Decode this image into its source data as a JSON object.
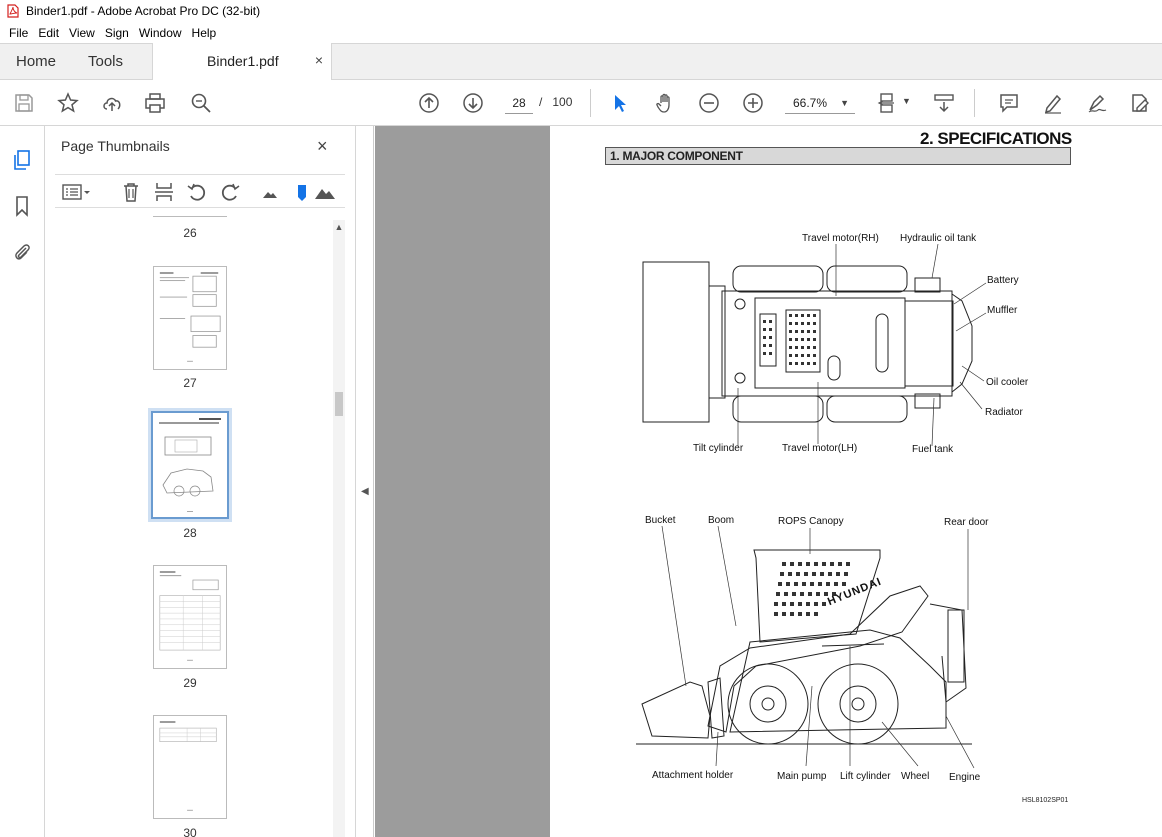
{
  "window": {
    "title": "Binder1.pdf - Adobe Acrobat Pro DC (32-bit)"
  },
  "menu": [
    "File",
    "Edit",
    "View",
    "Sign",
    "Window",
    "Help"
  ],
  "tabs": {
    "home": "Home",
    "tools": "Tools",
    "document": "Binder1.pdf",
    "close_glyph": "×"
  },
  "toolbar": {
    "current_page": "28",
    "page_separator": "/",
    "total_pages": "100",
    "zoom": "66.7%"
  },
  "thumbnail_panel": {
    "title": "Page Thumbnails",
    "close_glyph": "×",
    "thumbnails": [
      {
        "page": "26"
      },
      {
        "page": "27"
      },
      {
        "page": "28",
        "selected": true
      },
      {
        "page": "29"
      },
      {
        "page": "30"
      }
    ]
  },
  "document_page": {
    "section_title": "2. SPECIFICATIONS",
    "subsection_title": "1. MAJOR COMPONENT",
    "top_view_labels": {
      "travel_motor_rh": "Travel motor(RH)",
      "hydraulic_oil_tank": "Hydraulic oil tank",
      "battery": "Battery",
      "muffler": "Muffler",
      "oil_cooler": "Oil cooler",
      "radiator": "Radiator",
      "tilt_cylinder": "Tilt cylinder",
      "travel_motor_lh": "Travel motor(LH)",
      "fuel_tank": "Fuel tank"
    },
    "side_view_labels": {
      "bucket": "Bucket",
      "boom": "Boom",
      "rops_canopy": "ROPS Canopy",
      "rear_door": "Rear door",
      "attachment_holder": "Attachment holder",
      "main_pump": "Main pump",
      "lift_cylinder": "Lift cylinder",
      "wheel": "Wheel",
      "engine": "Engine"
    },
    "brand_text": "HYUNDAI",
    "figure_code": "HSL8102SP01"
  },
  "colors": {
    "accent": "#1473e6",
    "doc_background": "#9c9c9c",
    "pdf_red": "#d4201f"
  }
}
